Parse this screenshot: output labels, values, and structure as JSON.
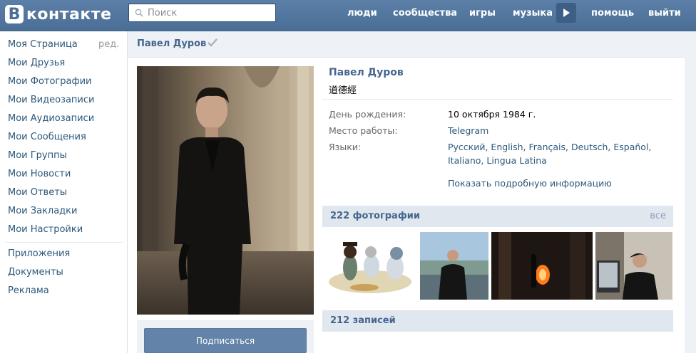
{
  "header": {
    "logo_letter": "В",
    "logo_text": "контакте",
    "search_placeholder": "Поиск",
    "nav": [
      "люди",
      "сообщества",
      "игры",
      "музыка",
      "помощь",
      "выйти"
    ]
  },
  "sidebar": {
    "edit_label": "ред.",
    "items": [
      "Моя Страница",
      "Мои Друзья",
      "Мои Фотографии",
      "Мои Видеозаписи",
      "Мои Аудиозаписи",
      "Мои Сообщения",
      "Мои Группы",
      "Мои Новости",
      "Мои Ответы",
      "Мои Закладки",
      "Мои Настройки"
    ],
    "extra_items": [
      "Приложения",
      "Документы",
      "Реклама"
    ]
  },
  "profile": {
    "page_title": "Павел Дуров",
    "name": "Павел Дуров",
    "status": "道德經",
    "info": [
      {
        "label": "День рождения:",
        "value": "10 октября 1984 г."
      },
      {
        "label": "Место работы:",
        "value": "Telegram"
      },
      {
        "label": "Языки:",
        "value_line1": "Русский, English, Français, Deutsch, Español,",
        "value_line2": "Italiano, Lingua Latina"
      }
    ],
    "more_info": "Показать подробную информацию",
    "subscribe_label": "Подписаться"
  },
  "photos": {
    "title": "222 фотографии",
    "all_label": "все"
  },
  "wall": {
    "title": "212 записей"
  },
  "colors": {
    "header_bg": "#4a6e96",
    "link": "#2b587a",
    "section_bg": "#e1e7ee",
    "button_bg": "#6383a8"
  }
}
